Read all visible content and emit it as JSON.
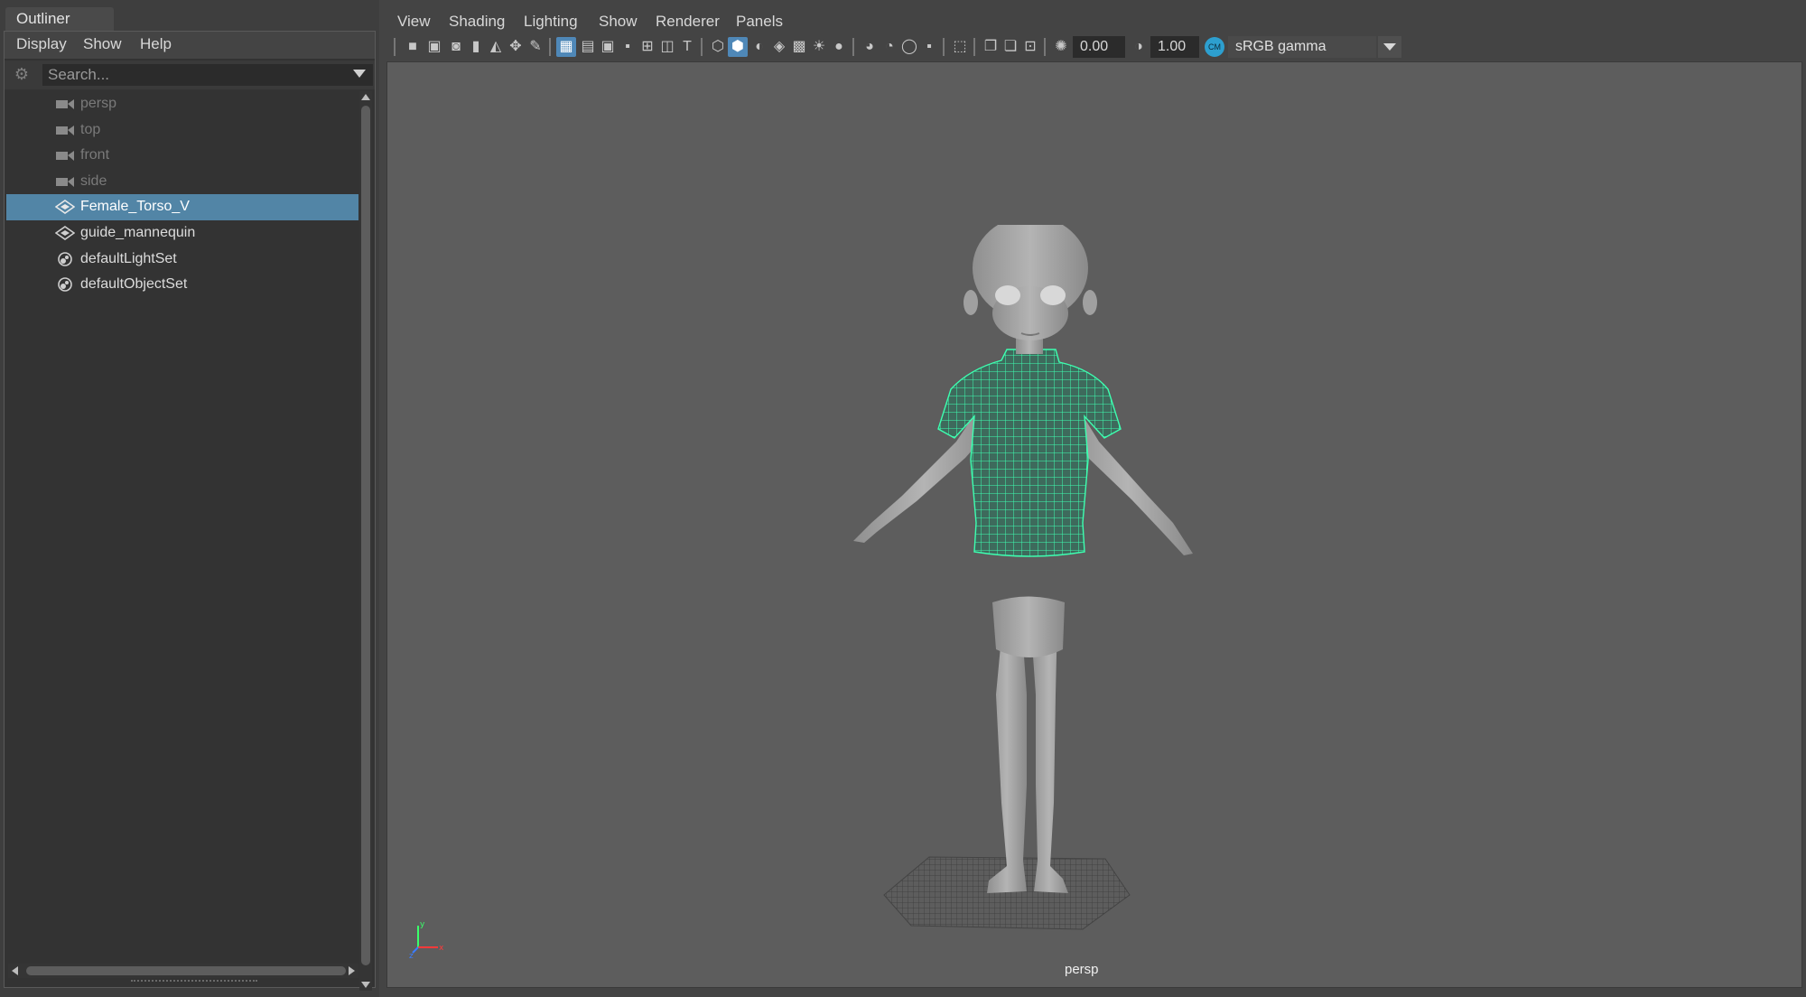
{
  "outliner": {
    "tab_label": "Outliner",
    "menu": [
      "Display",
      "Show",
      "Help"
    ],
    "search_placeholder": "Search...",
    "items": [
      {
        "label": "persp",
        "icon": "camera-icon",
        "state": "dim"
      },
      {
        "label": "top",
        "icon": "camera-icon",
        "state": "dim"
      },
      {
        "label": "front",
        "icon": "camera-icon",
        "state": "dim"
      },
      {
        "label": "side",
        "icon": "camera-icon",
        "state": "dim"
      },
      {
        "label": "Female_Torso_V",
        "icon": "mesh-transform-icon",
        "state": "selected"
      },
      {
        "label": "guide_mannequin",
        "icon": "mesh-transform-icon",
        "state": "normal"
      },
      {
        "label": "defaultLightSet",
        "icon": "set-icon",
        "state": "normal"
      },
      {
        "label": "defaultObjectSet",
        "icon": "set-icon",
        "state": "normal"
      }
    ]
  },
  "viewport": {
    "menu": [
      "View",
      "Shading",
      "Lighting",
      "Show",
      "Renderer",
      "Panels"
    ],
    "exposure_value": "0.00",
    "gamma_value": "1.00",
    "color_management_badge": "CM",
    "color_space": "sRGB gamma",
    "camera_name": "persp",
    "axis_labels": {
      "x": "x",
      "y": "y",
      "z": "z"
    }
  },
  "colors": {
    "selection": "#5285a6",
    "active_tool": "#4f88b8",
    "wireframe_highlight": "#3dffb0",
    "viewport_bg": "#5d5d5d"
  }
}
